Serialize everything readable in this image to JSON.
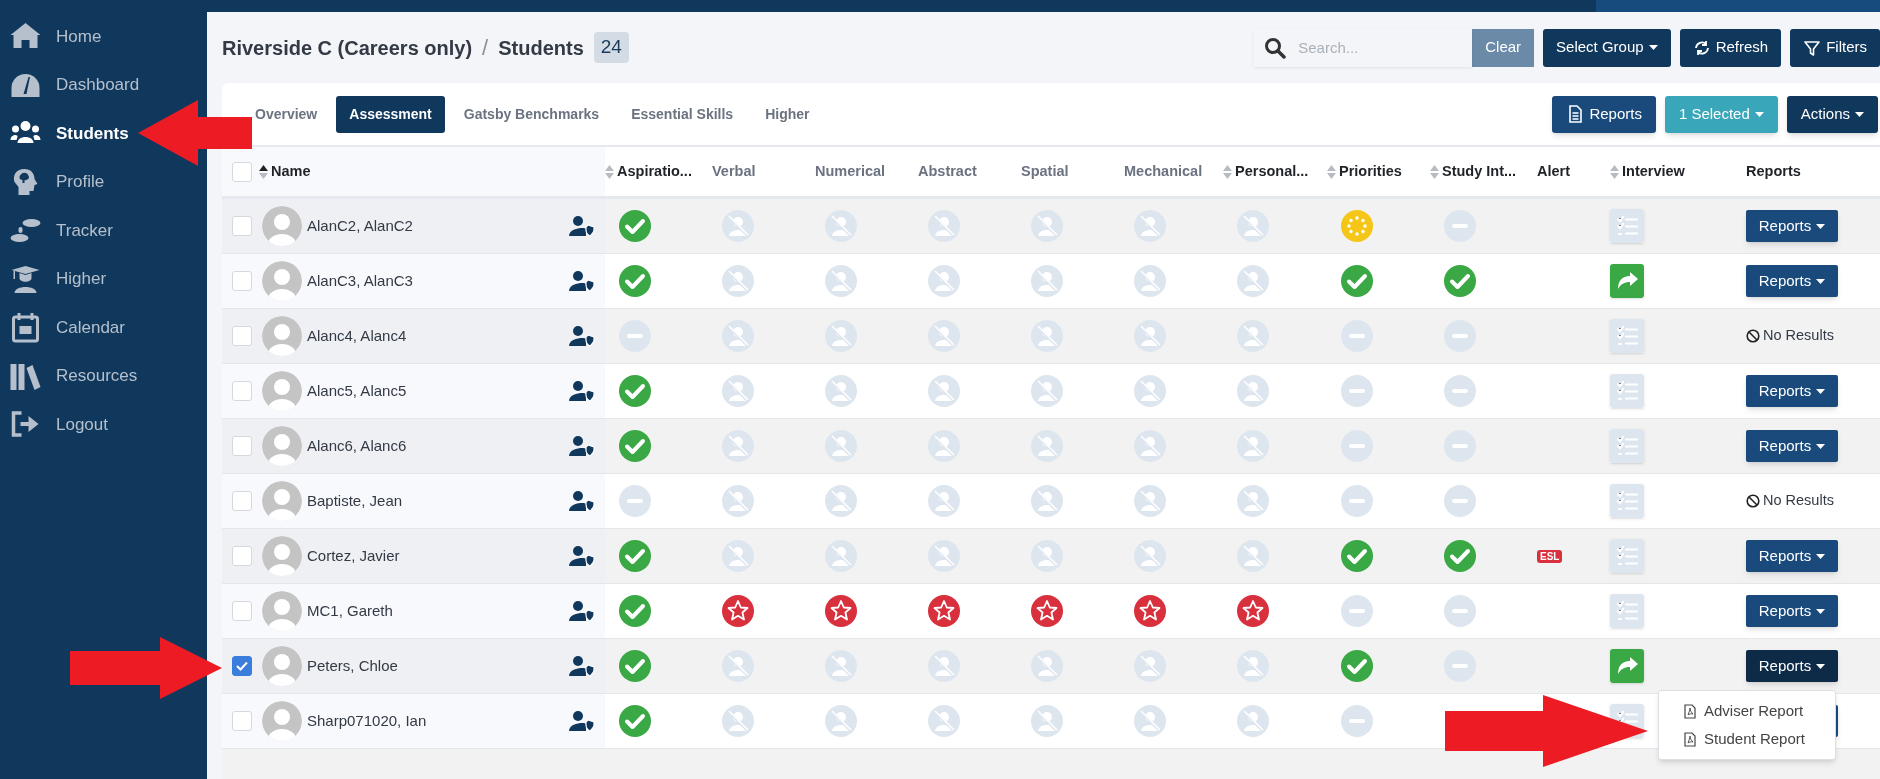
{
  "sidebar": {
    "items": [
      {
        "label": "Home",
        "selected": false
      },
      {
        "label": "Dashboard",
        "selected": false
      },
      {
        "label": "Students",
        "selected": true
      },
      {
        "label": "Profile",
        "selected": false
      },
      {
        "label": "Tracker",
        "selected": false
      },
      {
        "label": "Higher",
        "selected": false
      },
      {
        "label": "Calendar",
        "selected": false
      },
      {
        "label": "Resources",
        "selected": false
      },
      {
        "label": "Logout",
        "selected": false
      }
    ]
  },
  "breadcrumb": {
    "org": "Riverside C (Careers only)",
    "separator": "/",
    "page": "Students",
    "count": "24"
  },
  "search": {
    "placeholder": "Search...",
    "clear": "Clear"
  },
  "toolbar": [
    {
      "label": "Select Group",
      "caret": true
    },
    {
      "label": "Refresh"
    },
    {
      "label": "Filters"
    }
  ],
  "tabs": [
    {
      "label": "Overview",
      "selected": false
    },
    {
      "label": "Assessment",
      "selected": true
    },
    {
      "label": "Gatsby Benchmarks",
      "selected": false
    },
    {
      "label": "Essential Skills",
      "selected": false
    },
    {
      "label": "Higher",
      "selected": false
    }
  ],
  "actions": [
    {
      "label": "Reports",
      "kind": "primary"
    },
    {
      "label": "1 Selected",
      "kind": "info",
      "caret": true
    },
    {
      "label": "Actions",
      "kind": "dark",
      "caret": true
    }
  ],
  "table": {
    "select_all": {
      "checked": false
    },
    "columns": [
      {
        "label": "Name",
        "kind": "sortable",
        "sorted": true,
        "muted": false
      },
      {
        "label": "Aspiratio...",
        "kind": "sortable",
        "sorted": false,
        "muted": false
      },
      {
        "label": "Verbal",
        "kind": "plain",
        "muted": true
      },
      {
        "label": "Numerical",
        "kind": "plain",
        "muted": true
      },
      {
        "label": "Abstract",
        "kind": "plain",
        "muted": true
      },
      {
        "label": "Spatial",
        "kind": "plain",
        "muted": true
      },
      {
        "label": "Mechanical",
        "kind": "plain",
        "muted": true
      },
      {
        "label": "Personal...",
        "kind": "sortable",
        "sorted": false,
        "muted": false
      },
      {
        "label": "Priorities",
        "kind": "sortable",
        "sorted": false,
        "muted": false
      },
      {
        "label": "Study Int...",
        "kind": "sortable",
        "sorted": false,
        "muted": false
      },
      {
        "label": "Alert",
        "kind": "plain",
        "muted": false
      },
      {
        "label": "Interview",
        "kind": "sortable",
        "sorted": false,
        "muted": false
      },
      {
        "label": "Reports",
        "kind": "plain",
        "muted": false
      }
    ],
    "rows": [
      {
        "name": "AlanC2, AlanC2",
        "checked": false,
        "results": [
          {
            "kind": "check"
          },
          {
            "kind": "disabled"
          },
          {
            "kind": "disabled"
          },
          {
            "kind": "disabled"
          },
          {
            "kind": "disabled"
          },
          {
            "kind": "disabled"
          },
          {
            "kind": "disabled"
          },
          {
            "kind": "pending"
          },
          {
            "kind": "minus"
          }
        ],
        "interview": {
          "kind": "list"
        },
        "reports": {
          "kind": "button",
          "label": "Reports"
        }
      },
      {
        "name": "AlanC3, AlanC3",
        "checked": false,
        "results": [
          {
            "kind": "check"
          },
          {
            "kind": "disabled"
          },
          {
            "kind": "disabled"
          },
          {
            "kind": "disabled"
          },
          {
            "kind": "disabled"
          },
          {
            "kind": "disabled"
          },
          {
            "kind": "disabled"
          },
          {
            "kind": "check"
          },
          {
            "kind": "check"
          }
        ],
        "interview": {
          "kind": "forward"
        },
        "reports": {
          "kind": "button",
          "label": "Reports"
        }
      },
      {
        "name": "Alanc4, Alanc4",
        "checked": false,
        "results": [
          {
            "kind": "minus"
          },
          {
            "kind": "disabled"
          },
          {
            "kind": "disabled"
          },
          {
            "kind": "disabled"
          },
          {
            "kind": "disabled"
          },
          {
            "kind": "disabled"
          },
          {
            "kind": "disabled"
          },
          {
            "kind": "minus"
          },
          {
            "kind": "minus"
          }
        ],
        "interview": {
          "kind": "list"
        },
        "reports": {
          "kind": "none",
          "label": "No Results"
        }
      },
      {
        "name": "Alanc5, Alanc5",
        "checked": false,
        "results": [
          {
            "kind": "check"
          },
          {
            "kind": "disabled"
          },
          {
            "kind": "disabled"
          },
          {
            "kind": "disabled"
          },
          {
            "kind": "disabled"
          },
          {
            "kind": "disabled"
          },
          {
            "kind": "disabled"
          },
          {
            "kind": "minus"
          },
          {
            "kind": "minus"
          }
        ],
        "interview": {
          "kind": "list"
        },
        "reports": {
          "kind": "button",
          "label": "Reports"
        }
      },
      {
        "name": "Alanc6, Alanc6",
        "checked": false,
        "results": [
          {
            "kind": "check"
          },
          {
            "kind": "disabled"
          },
          {
            "kind": "disabled"
          },
          {
            "kind": "disabled"
          },
          {
            "kind": "disabled"
          },
          {
            "kind": "disabled"
          },
          {
            "kind": "disabled"
          },
          {
            "kind": "minus"
          },
          {
            "kind": "minus"
          }
        ],
        "interview": {
          "kind": "list"
        },
        "reports": {
          "kind": "button",
          "label": "Reports"
        }
      },
      {
        "name": "Baptiste, Jean",
        "checked": false,
        "results": [
          {
            "kind": "minus"
          },
          {
            "kind": "disabled"
          },
          {
            "kind": "disabled"
          },
          {
            "kind": "disabled"
          },
          {
            "kind": "disabled"
          },
          {
            "kind": "disabled"
          },
          {
            "kind": "disabled"
          },
          {
            "kind": "minus"
          },
          {
            "kind": "minus"
          }
        ],
        "interview": {
          "kind": "list"
        },
        "reports": {
          "kind": "none",
          "label": "No Results"
        }
      },
      {
        "name": "Cortez, Javier",
        "checked": false,
        "results": [
          {
            "kind": "check"
          },
          {
            "kind": "disabled"
          },
          {
            "kind": "disabled"
          },
          {
            "kind": "disabled"
          },
          {
            "kind": "disabled"
          },
          {
            "kind": "disabled"
          },
          {
            "kind": "disabled"
          },
          {
            "kind": "check"
          },
          {
            "kind": "check"
          }
        ],
        "alert": "ESL",
        "interview": {
          "kind": "list"
        },
        "reports": {
          "kind": "button",
          "label": "Reports"
        }
      },
      {
        "name": "MC1, Gareth",
        "checked": false,
        "results": [
          {
            "kind": "check"
          },
          {
            "kind": "star"
          },
          {
            "kind": "star"
          },
          {
            "kind": "star"
          },
          {
            "kind": "star"
          },
          {
            "kind": "star"
          },
          {
            "kind": "star"
          },
          {
            "kind": "minus"
          },
          {
            "kind": "minus"
          }
        ],
        "interview": {
          "kind": "list"
        },
        "reports": {
          "kind": "button",
          "label": "Reports"
        }
      },
      {
        "name": "Peters, Chloe",
        "checked": true,
        "results": [
          {
            "kind": "check"
          },
          {
            "kind": "disabled"
          },
          {
            "kind": "disabled"
          },
          {
            "kind": "disabled"
          },
          {
            "kind": "disabled"
          },
          {
            "kind": "disabled"
          },
          {
            "kind": "disabled"
          },
          {
            "kind": "check"
          },
          {
            "kind": "minus"
          }
        ],
        "interview": {
          "kind": "forward"
        },
        "reports": {
          "kind": "button",
          "label": "Reports",
          "open": true,
          "menu": [
            "Adviser Report",
            "Student Report"
          ]
        }
      },
      {
        "name": "Sharp071020, Ian",
        "checked": false,
        "results": [
          {
            "kind": "check"
          },
          {
            "kind": "disabled"
          },
          {
            "kind": "disabled"
          },
          {
            "kind": "disabled"
          },
          {
            "kind": "disabled"
          },
          {
            "kind": "disabled"
          },
          {
            "kind": "disabled"
          },
          {
            "kind": "minus"
          }
        ],
        "interview": {
          "kind": "list"
        },
        "reports": {
          "kind": "button"
        }
      }
    ]
  },
  "annotation_arrows": [
    {
      "kind": "left"
    },
    {
      "kind": "right"
    },
    {
      "kind": "right"
    }
  ]
}
